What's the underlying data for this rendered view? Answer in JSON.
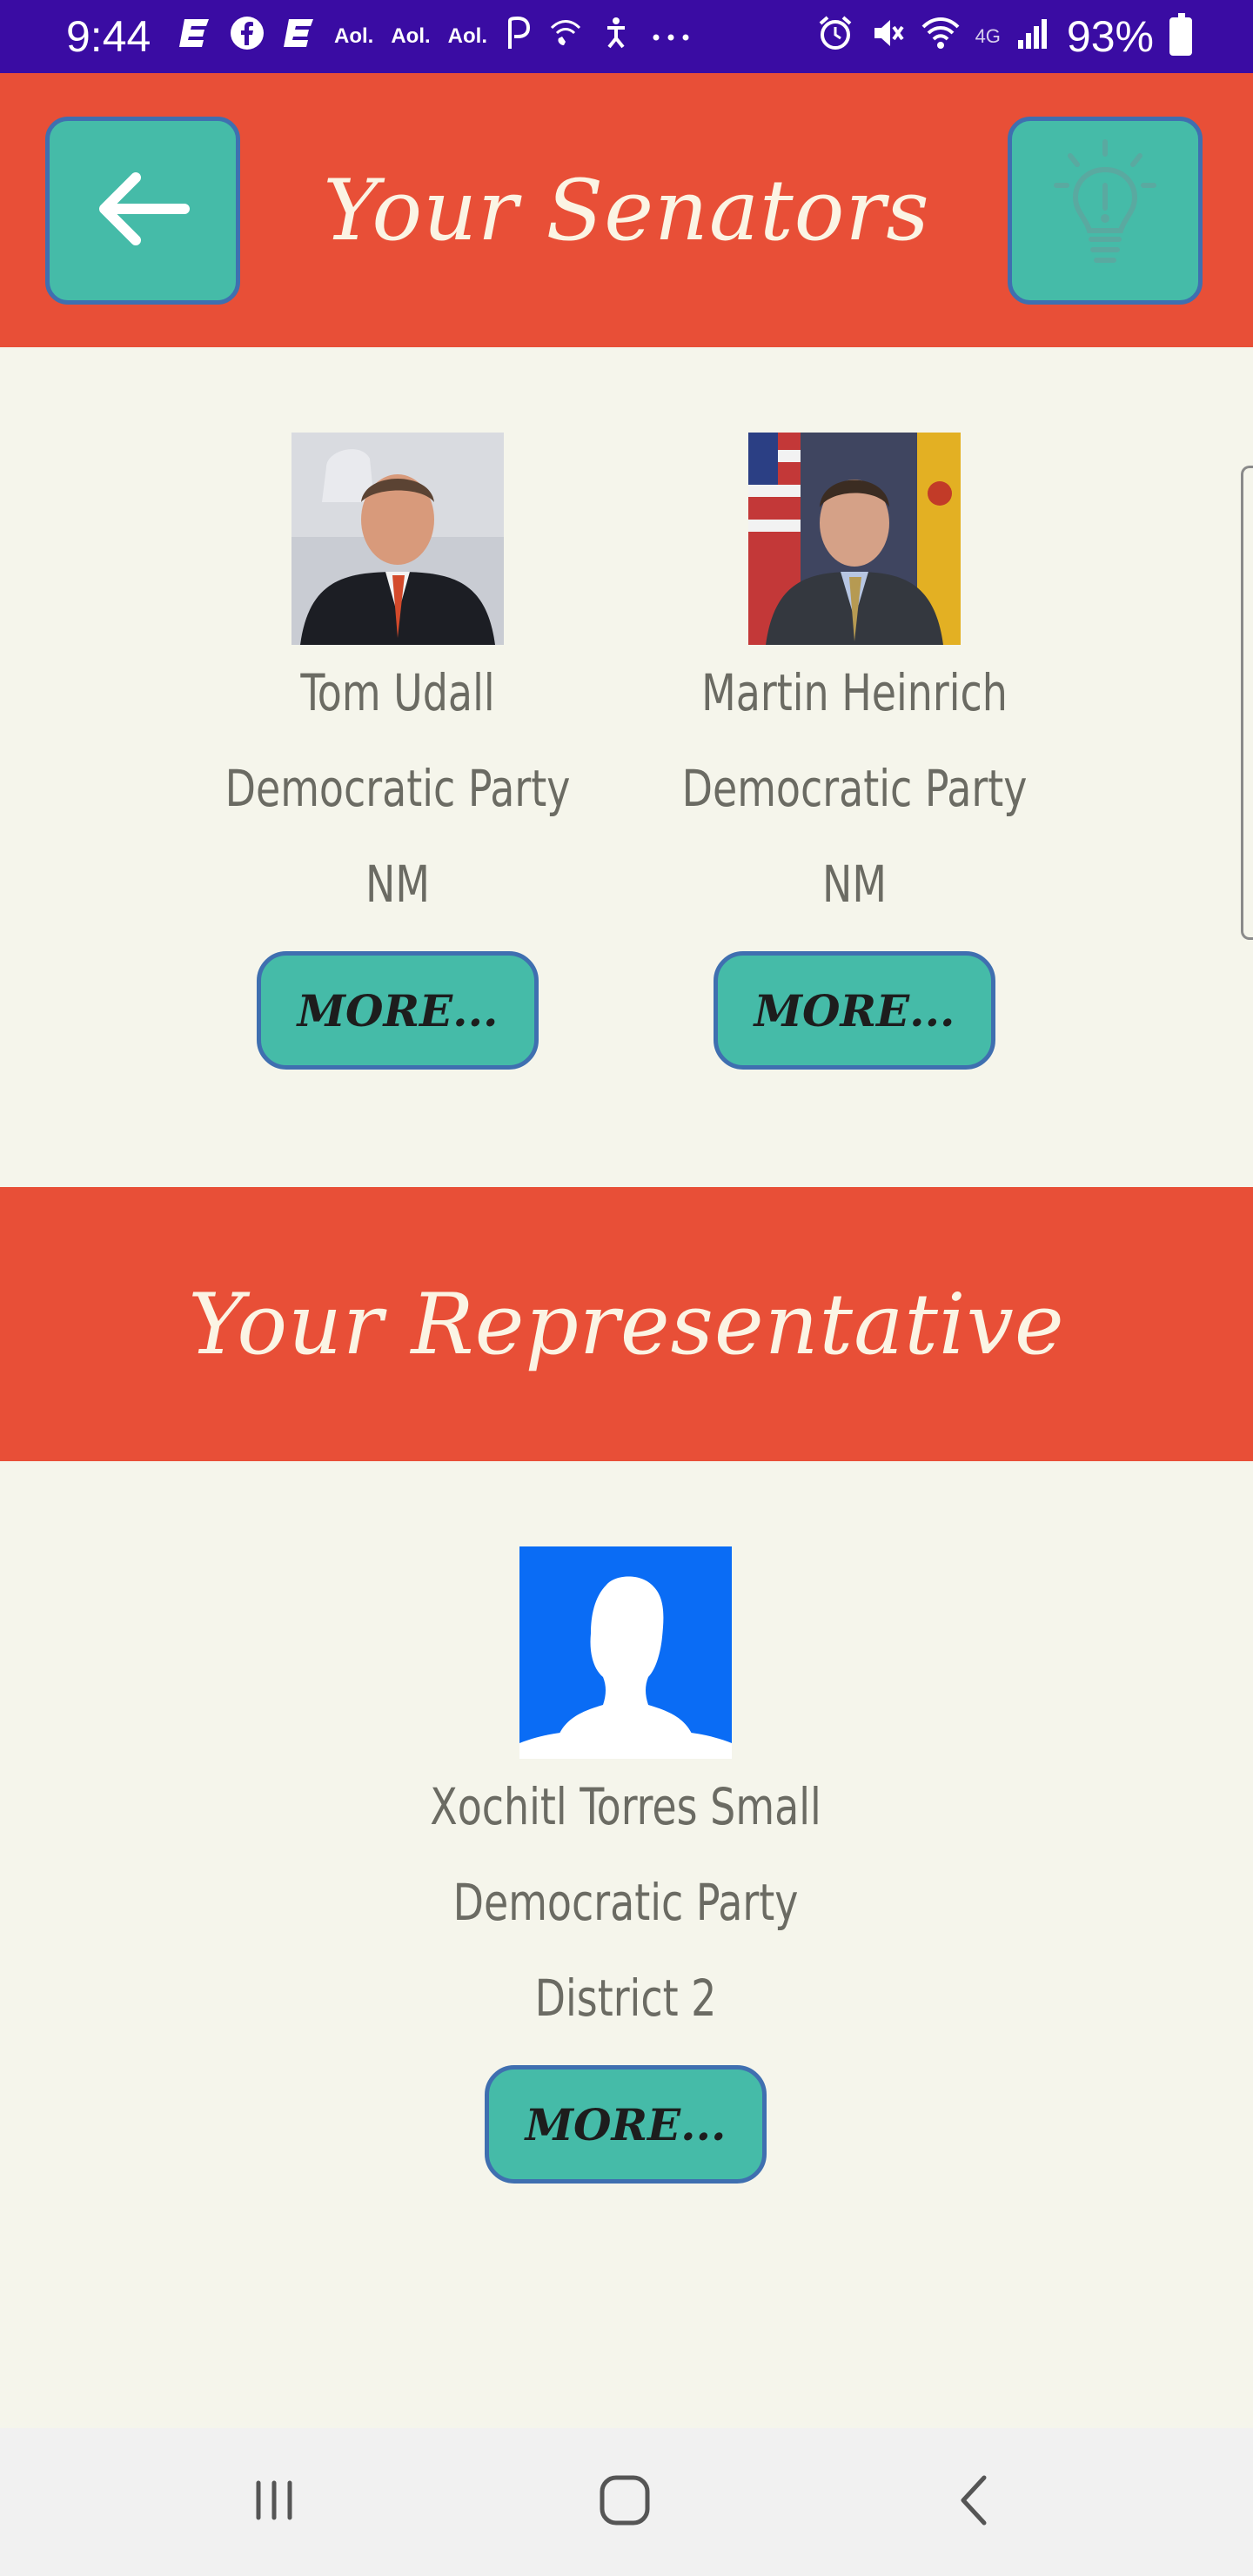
{
  "status_bar": {
    "time": "9:44",
    "aol_labels": [
      "Aol.",
      "Aol.",
      "Aol."
    ],
    "battery_percent": "93%",
    "icons": [
      "e-app-icon",
      "facebook-icon",
      "e-app-icon",
      "aol-icon",
      "aol-icon",
      "aol-icon",
      "p-app-icon",
      "wifi-call-icon",
      "accessibility-icon",
      "more-dots-icon",
      "alarm-icon",
      "mute-icon",
      "wifi-icon",
      "4g-icon",
      "signal-icon",
      "battery-icon"
    ]
  },
  "senators_header": {
    "title": "Your Senators",
    "back_icon": "arrow-left-icon",
    "hint_icon": "lightbulb-icon"
  },
  "senators": [
    {
      "name": "Tom Udall",
      "party": "Democratic Party",
      "state": "NM",
      "more_label": "MORE..."
    },
    {
      "name": "Martin Heinrich",
      "party": "Democratic Party",
      "state": "NM",
      "more_label": "MORE..."
    }
  ],
  "representative_header": {
    "title": "Your Representative"
  },
  "representative": {
    "name": "Xochitl Torres Small",
    "party": "Democratic Party",
    "district": "District 2",
    "more_label": "MORE..."
  },
  "colors": {
    "status_bar": "#3a0ca3",
    "header": "#e84f37",
    "button": "#45bba8",
    "button_border": "#3f6fb0",
    "background": "#f5f5eb",
    "text": "#6b6b63"
  },
  "nav_bar": {
    "icons": [
      "recent-apps-icon",
      "home-icon",
      "back-icon"
    ]
  }
}
